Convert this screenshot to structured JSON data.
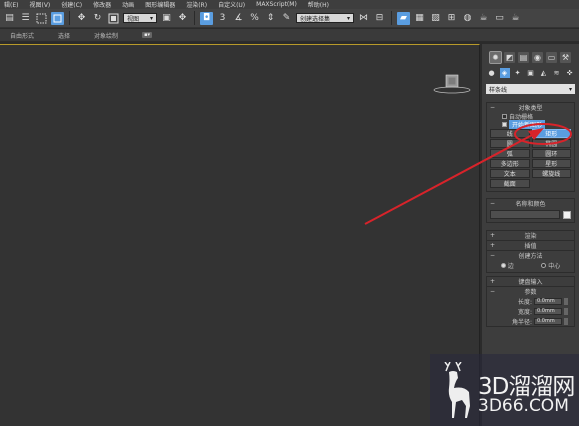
{
  "menu": [
    "辑(E)",
    "视图(V)",
    "创建(C)",
    "修改器",
    "动画",
    "图形编辑器",
    "渲染(R)",
    "自定义(U)",
    "MAXScript(M)",
    "帮助(H)"
  ],
  "toolbar": {
    "view_dropdown": "视图",
    "selection_set_dropdown": "创建选择集",
    "snap_label": "3"
  },
  "ribbon": [
    "自由形式",
    "选择",
    "对象绘制"
  ],
  "panel": {
    "category_dropdown": "样条线",
    "object_type": {
      "title": "对象类型",
      "auto_grid": "自动栅格",
      "start_new_shape": "开始新图形",
      "buttons": [
        "线",
        "矩形",
        "圆",
        "椭圆",
        "弧",
        "圆环",
        "多边形",
        "星形",
        "文本",
        "螺旋线",
        "截面"
      ],
      "active_button": "矩形"
    },
    "name_color": {
      "title": "名称和颜色"
    },
    "render_rollout": "渲染",
    "interp_rollout": "插值",
    "creation_method": {
      "title": "创建方法",
      "options": [
        "边",
        "中心"
      ],
      "selected": "边"
    },
    "keyboard_rollout": "键盘输入",
    "params": {
      "title": "参数",
      "fields": [
        {
          "label": "长度:",
          "value": "0.0mm"
        },
        {
          "label": "宽度:",
          "value": "0.0mm"
        },
        {
          "label": "角半径:",
          "value": "0.0mm"
        }
      ]
    }
  },
  "watermark": {
    "brand": "3D溜溜网",
    "url": "3D66.COM"
  },
  "colors": {
    "accent": "#5a9de0",
    "annotation": "#d8232a",
    "viewport": "#333333"
  }
}
